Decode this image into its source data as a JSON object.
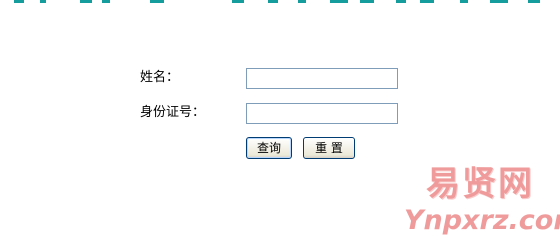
{
  "form": {
    "name_label": "姓名：",
    "name_value": "",
    "id_label": "身份证号：",
    "id_value": "",
    "query_button": "查询",
    "reset_button": "重 置"
  },
  "watermark": {
    "chinese": "易贤网",
    "url": "Ynpxrz.com"
  },
  "colors": {
    "top_strip": "#159c9c",
    "input_border": "#7f9db9",
    "button_border": "#003c74",
    "watermark": "#e34a4a"
  }
}
